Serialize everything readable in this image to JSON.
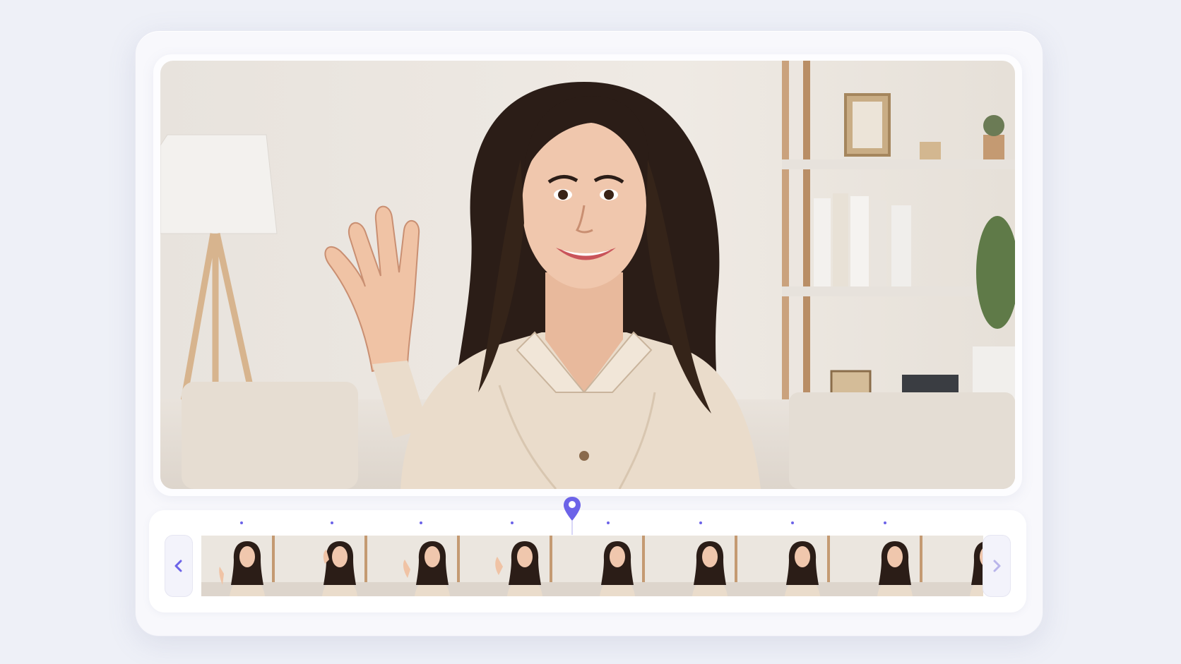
{
  "player": {
    "preview_alt": "",
    "colors": {
      "accent": "#6c63e8",
      "background": "#eef0f7",
      "wall": "#ece8e3",
      "sweater": "#eadccb",
      "hair": "#2b1d17",
      "skin": "#f0c7ad"
    }
  },
  "timeline": {
    "tick_count": 8,
    "frame_count": 9,
    "playhead_icon": "location-pin-icon",
    "prev_icon": "chevron-left-icon",
    "next_icon": "chevron-right-icon"
  }
}
